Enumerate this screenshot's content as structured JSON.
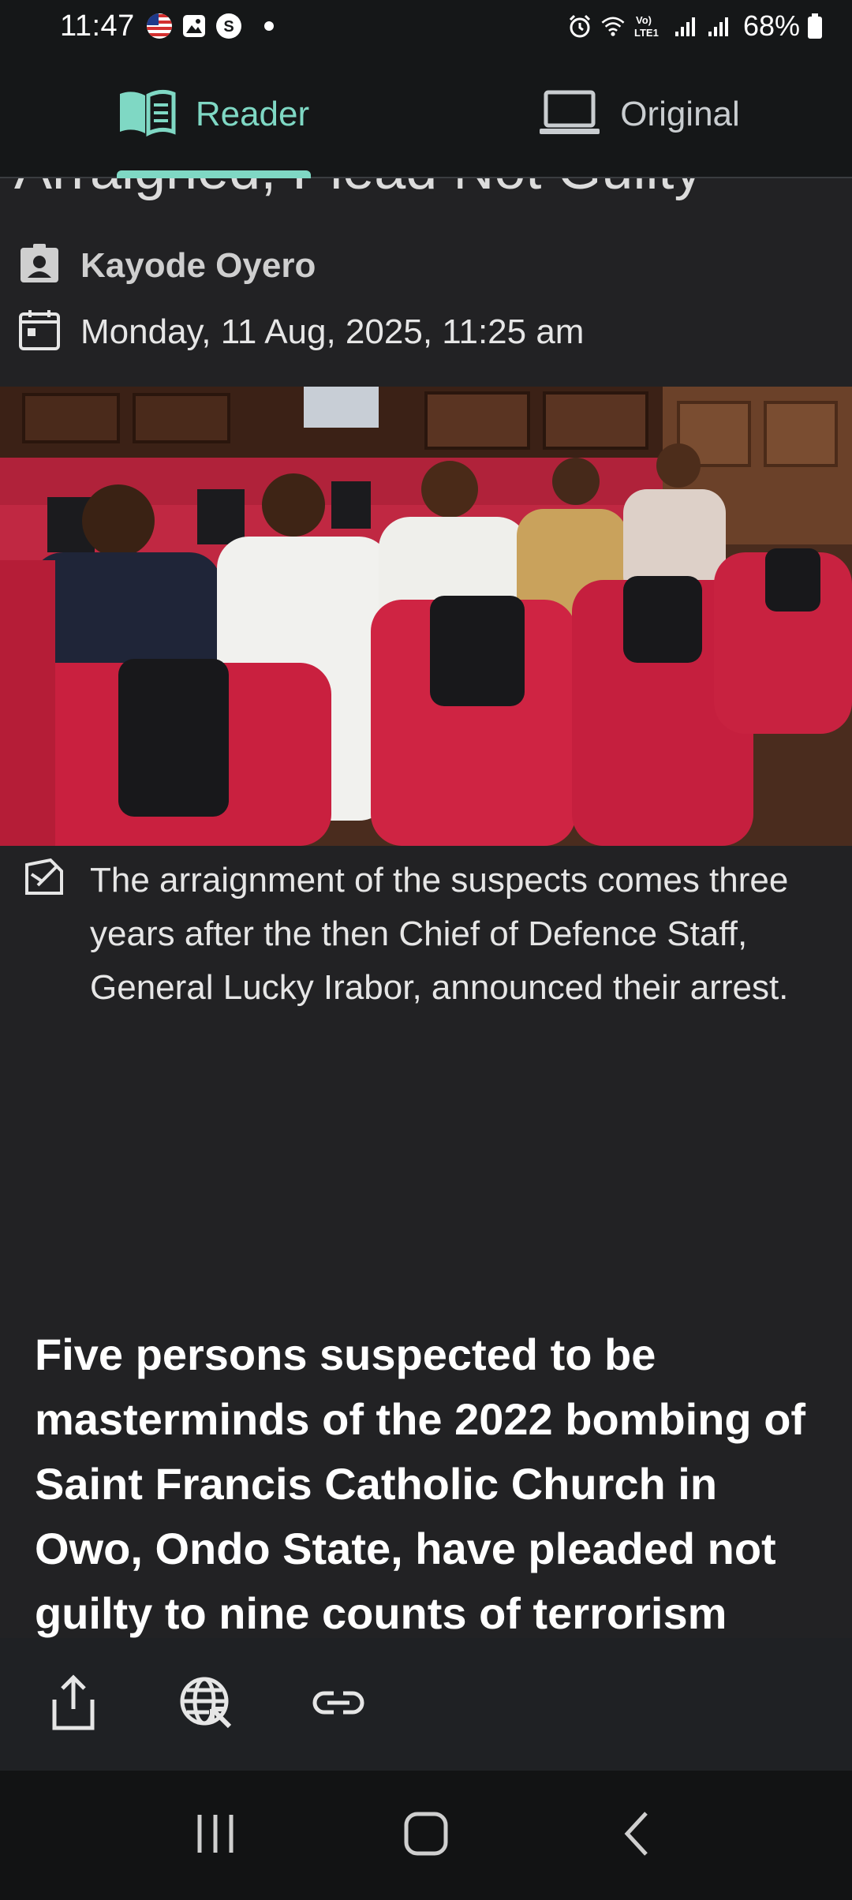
{
  "status_bar": {
    "time": "11:47",
    "battery": "68%",
    "icons_left": [
      "us-flag-icon",
      "gallery-icon",
      "s-app-icon",
      "notification-dot"
    ],
    "icons_right": [
      "alarm-icon",
      "wifi-icon",
      "volte-icon",
      "signal-icon",
      "signal-icon",
      "battery-icon"
    ],
    "volte_label": "Vo)\nLTE1"
  },
  "tabs": [
    {
      "label": "Reader",
      "icon": "book-icon",
      "active": true
    },
    {
      "label": "Original",
      "icon": "laptop-icon",
      "active": false
    }
  ],
  "article": {
    "headline_partial": "Arraigned, Plead Not Guilty",
    "author": "Kayode Oyero",
    "date": "Monday, 11 Aug, 2025, 11:25 am",
    "image_caption": "The arraignment of the suspects comes three years after the then Chief of Defence Staff, General Lucky Irabor, announced their arrest.",
    "lead": "Five persons suspected to be masterminds of the 2022 bombing of Saint Francis Catholic Church in Owo, Ondo State, have pleaded not guilty to nine counts of terrorism"
  },
  "action_bar": [
    "share-icon",
    "open-in-browser-icon",
    "link-icon"
  ],
  "nav_bar": [
    "recent-apps-icon",
    "home-icon",
    "back-icon"
  ],
  "colors": {
    "accent": "#7fd8c4",
    "background": "#222224",
    "bar": "#151718"
  }
}
